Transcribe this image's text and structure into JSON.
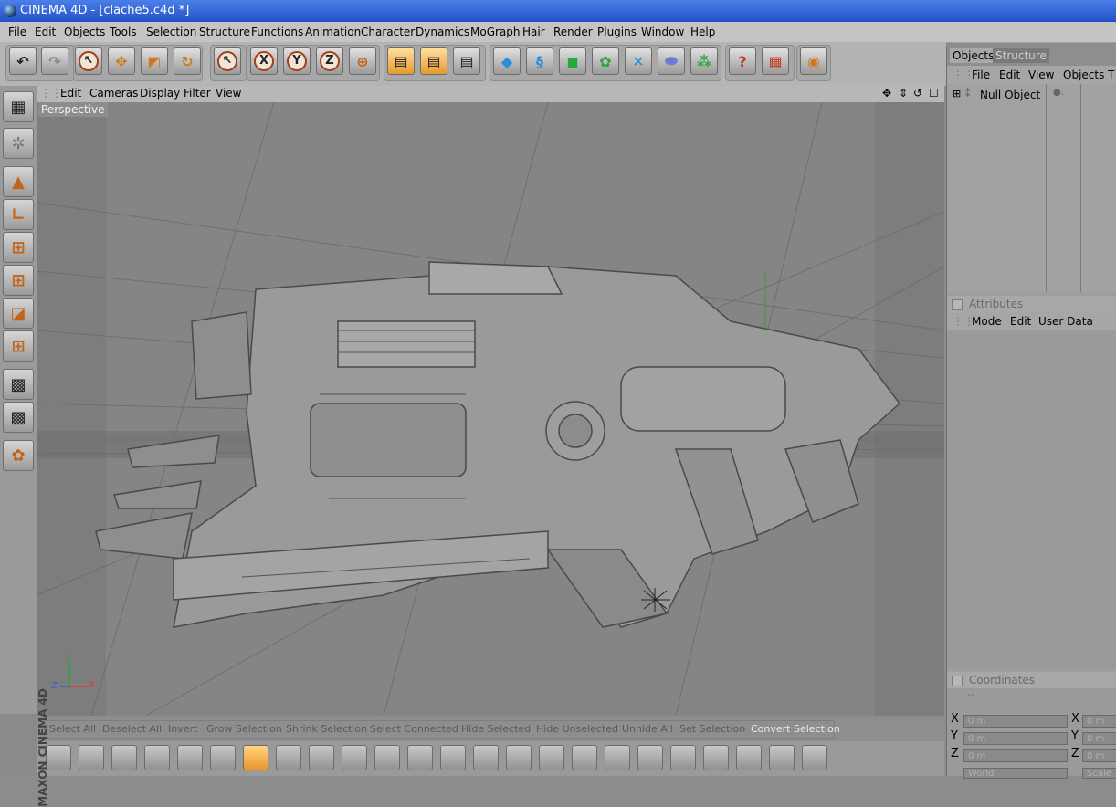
{
  "window": {
    "title": "CINEMA 4D - [clache5.c4d *]"
  },
  "menu": [
    "File",
    "Edit",
    "Objects",
    "Tools",
    "Selection",
    "Structure",
    "Functions",
    "Animation",
    "Character",
    "Dynamics",
    "MoGraph",
    "Hair",
    "Render",
    "Plugins",
    "Window",
    "Help"
  ],
  "toolbar": {
    "axis_x": "X",
    "axis_y": "Y",
    "axis_z": "Z"
  },
  "viewport": {
    "menu": [
      "Edit",
      "Cameras",
      "Display",
      "Filter",
      "View"
    ],
    "label": "Perspective",
    "axis_y": "Y",
    "axis_z": "Z",
    "axis_x": "X"
  },
  "commands": [
    "Select All",
    "Deselect All",
    "Invert",
    "Grow Selection",
    "Shrink Selection",
    "Select Connected",
    "Hide Selected",
    "Hide Unselected",
    "Unhide All",
    "Set Selection",
    "Convert Selection"
  ],
  "brand": {
    "line1": "MAXON",
    "line2": "CINEMA 4D"
  },
  "objects_panel": {
    "tabs": [
      "Objects",
      "Structure"
    ],
    "menu": [
      "File",
      "Edit",
      "View",
      "Objects",
      "T"
    ],
    "tree": [
      {
        "name": "Null Object"
      }
    ]
  },
  "attributes_panel": {
    "title": "Attributes",
    "menu": [
      "Mode",
      "Edit",
      "User Data"
    ]
  },
  "coordinates_panel": {
    "title": "Coordinates",
    "first_col": "--",
    "rows": [
      {
        "axis": "X",
        "value": "0 m",
        "axis2": "X",
        "value2": "0 m"
      },
      {
        "axis": "Y",
        "value": "0 m",
        "axis2": "Y",
        "value2": "0 m"
      },
      {
        "axis": "Z",
        "value": "0 m",
        "axis2": "Z",
        "value2": "0 m"
      }
    ],
    "space": "World",
    "mode": "Scale"
  },
  "colors": {
    "title_bar": "#2a55cf",
    "accent_orange": "#e8962c",
    "viewport_bg": "#7c7c7c"
  }
}
